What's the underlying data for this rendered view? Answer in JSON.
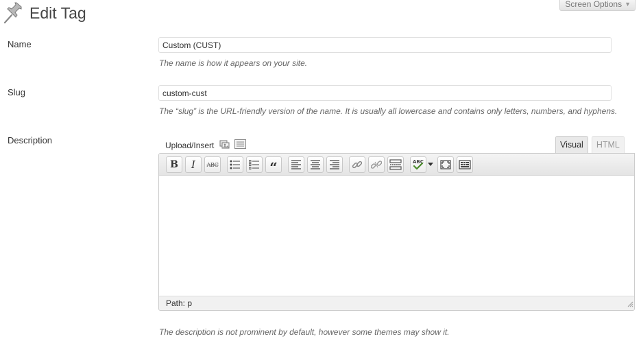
{
  "screen_options": {
    "label": "Screen Options"
  },
  "header": {
    "title": "Edit Tag"
  },
  "fields": {
    "name": {
      "label": "Name",
      "value": "Custom (CUST)",
      "help": "The name is how it appears on your site."
    },
    "slug": {
      "label": "Slug",
      "value": "custom-cust",
      "help": "The “slug” is the URL-friendly version of the name. It is usually all lowercase and contains only letters, numbers, and hyphens."
    },
    "description": {
      "label": "Description",
      "upload_label": "Upload/Insert",
      "tabs": {
        "visual": "Visual",
        "html": "HTML"
      },
      "toolbar": {
        "bold": "B",
        "italic": "I",
        "strikethrough": "ABC",
        "blockquote": "“",
        "spellcheck_text": "ABC"
      },
      "status_path_label": "Path:",
      "status_path_value": "p",
      "help": "The description is not prominent by default, however some themes may show it."
    }
  },
  "icons": [
    "pushpin-icon",
    "upload-image-icon",
    "media-library-icon",
    "bold-icon",
    "italic-icon",
    "strikethrough-icon",
    "bullet-list-icon",
    "numbered-list-icon",
    "blockquote-icon",
    "align-left-icon",
    "align-center-icon",
    "align-right-icon",
    "link-icon",
    "unlink-icon",
    "more-tag-icon",
    "spellcheck-icon",
    "chevron-down-icon",
    "fullscreen-icon",
    "kitchen-sink-icon",
    "resize-handle-icon"
  ]
}
